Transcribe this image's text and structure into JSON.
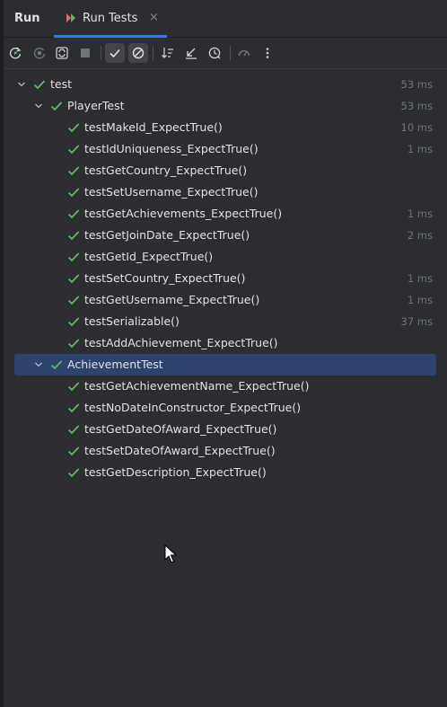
{
  "window": {
    "title": "Run"
  },
  "tab": {
    "label": "Run Tests",
    "close": "×",
    "icon": "run-tests-icon"
  },
  "toolbar": {
    "buttons": [
      {
        "name": "rerun-icon"
      },
      {
        "name": "rerun-failed-icon"
      },
      {
        "name": "toggle-auto-test-icon"
      },
      {
        "name": "stop-icon"
      },
      {
        "name": "show-passed-icon",
        "active": true
      },
      {
        "name": "show-ignored-icon",
        "active": true
      },
      {
        "name": "sort-alphabetically-icon"
      },
      {
        "name": "import-tests-icon"
      },
      {
        "name": "history-icon"
      },
      {
        "name": "coverage-icon"
      },
      {
        "name": "more-options-icon"
      }
    ]
  },
  "tree": {
    "root": {
      "label": "test",
      "duration": "53 ms"
    },
    "suites": [
      {
        "label": "PlayerTest",
        "duration": "53 ms",
        "selected": false,
        "tests": [
          {
            "label": "testMakeId_ExpectTrue()",
            "duration": "10 ms"
          },
          {
            "label": "testIdUniqueness_ExpectTrue()",
            "duration": "1 ms"
          },
          {
            "label": "testGetCountry_ExpectTrue()",
            "duration": ""
          },
          {
            "label": "testSetUsername_ExpectTrue()",
            "duration": ""
          },
          {
            "label": "testGetAchievements_ExpectTrue()",
            "duration": "1 ms"
          },
          {
            "label": "testGetJoinDate_ExpectTrue()",
            "duration": "2 ms"
          },
          {
            "label": "testGetId_ExpectTrue()",
            "duration": ""
          },
          {
            "label": "testSetCountry_ExpectTrue()",
            "duration": "1 ms"
          },
          {
            "label": "testGetUsername_ExpectTrue()",
            "duration": "1 ms"
          },
          {
            "label": "testSerializable()",
            "duration": "37 ms"
          },
          {
            "label": "testAddAchievement_ExpectTrue()",
            "duration": ""
          }
        ]
      },
      {
        "label": "AchievementTest",
        "duration": "",
        "selected": true,
        "tests": [
          {
            "label": "testGetAchievementName_ExpectTrue()",
            "duration": ""
          },
          {
            "label": "testNoDateInConstructor_ExpectTrue()",
            "duration": ""
          },
          {
            "label": "testGetDateOfAward_ExpectTrue()",
            "duration": ""
          },
          {
            "label": "testSetDateOfAward_ExpectTrue()",
            "duration": ""
          },
          {
            "label": "testGetDescription_ExpectTrue()",
            "duration": ""
          }
        ]
      }
    ]
  },
  "colors": {
    "pass": "#5fb865",
    "accent": "#3574f0",
    "selection": "#2e436e"
  }
}
